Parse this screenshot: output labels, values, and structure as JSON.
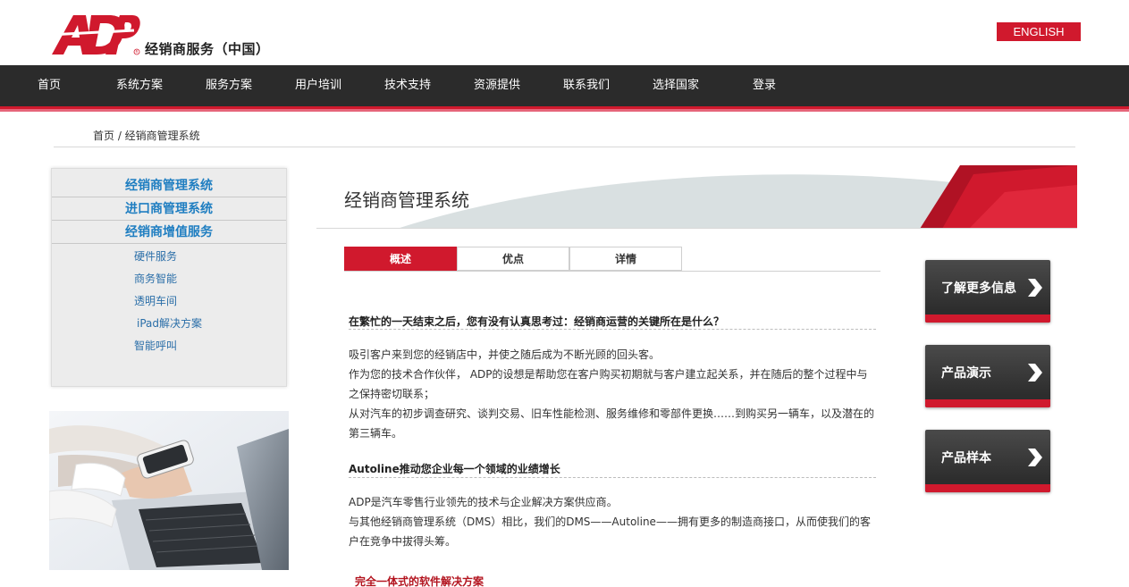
{
  "header": {
    "logo_text": "ADP",
    "subtitle": "经销商服务（中国）",
    "lang_button": "ENGLISH"
  },
  "nav": {
    "items": [
      "首页",
      "系统方案",
      "服务方案",
      "用户培训",
      "技术支持",
      "资源提供",
      "联系我们",
      "选择国家",
      "登录"
    ]
  },
  "breadcrumb": "首页 / 经销商管理系统",
  "sidebar": {
    "main": [
      "经销商管理系统",
      "进口商管理系统",
      "经销商增值服务"
    ],
    "sub": [
      "硬件服务",
      "商务智能",
      "透明车间",
      "iPad解决方案",
      "智能呼叫"
    ]
  },
  "page": {
    "title": "经销商管理系统",
    "tabs": [
      "概述",
      "优点",
      "详情"
    ],
    "active_tab": 0
  },
  "content": {
    "heading1": "在繁忙的一天结束之后，您有没有认真思考过：经销商运营的关键所在是什么？",
    "para1": [
      "吸引客户来到您的经销店中，并使之随后成为不断光顾的回头客。",
      "作为您的技术合作伙伴， ADP的设想是帮助您在客户购买初期就与客户建立起关系，并在随后的整个过程中与",
      "之保持密切联系；",
      "从对汽车的初步调查研究、谈判交易、旧车性能检测、服务维修和零部件更换……到购买另一辆车，以及潜在的",
      "第三辆车。"
    ],
    "heading2": "Autoline推动您企业每一个领域的业绩增长",
    "para2": [
      " ADP是汽车零售行业领先的技术与企业解决方案供应商。",
      "与其他经销商管理系统（DMS）相比，我们的DMS——Autoline——拥有更多的制造商接口，从而使我们的客",
      "户在竞争中拔得头筹。"
    ],
    "heading3": "完全一体式的软件解决方案"
  },
  "cta": [
    "了解更多信息",
    "产品演示",
    "产品样本"
  ],
  "colors": {
    "brand_red": "#d0192d",
    "nav_bg": "#2b2b2b",
    "link_blue": "#1f7ec1"
  }
}
